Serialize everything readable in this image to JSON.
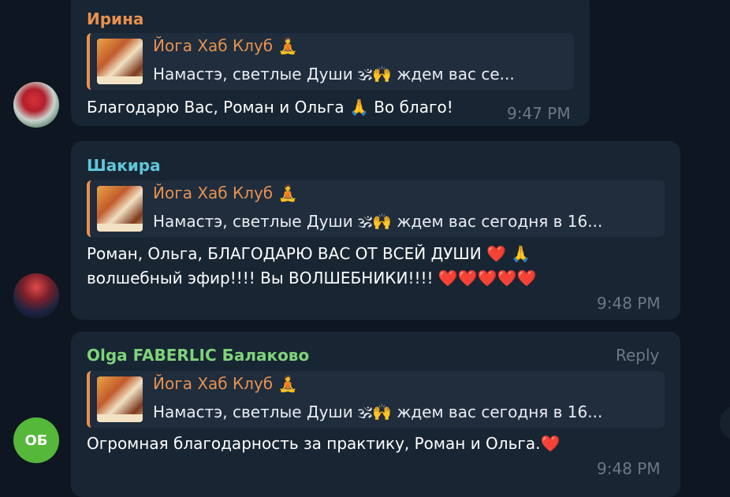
{
  "messages": [
    {
      "sender": "Ирина",
      "sender_color": "#e8914e",
      "quote_title": "Йога Хаб Клуб 🧘",
      "quote_text": "Намастэ, светлые Души 🕉🙌 ждем вас се...",
      "text_lines": [
        "Благодарю Вас, Роман и Ольга 🙏 Во благо!"
      ],
      "time": "9:47 PM"
    },
    {
      "sender": "Шакира",
      "sender_color": "#5fc6d8",
      "quote_title": "Йога Хаб Клуб 🧘",
      "quote_text": "Намастэ, светлые Души 🕉🙌 ждем вас сегодня в 16...",
      "text_lines": [
        "Роман, Ольга, БЛАГОДАРЮ ВАС ОТ ВСЕЙ ДУШИ ❤️ 🙏",
        "волшебный эфир!!!! Вы ВОЛШЕБНИКИ!!!! ❤️❤️❤️❤️❤️"
      ],
      "time": "9:48 PM"
    },
    {
      "sender": "Olga FABERLIC Балаково",
      "sender_color": "#7fd37b",
      "reply_label": "Reply",
      "quote_title": "Йога Хаб Клуб 🧘",
      "quote_text": "Намастэ, светлые Души 🕉🙌 ждем вас сегодня в 16...",
      "text_lines": [
        "Огромная благодарность за практику, Роман и Ольга.❤️"
      ],
      "time": "9:48 PM",
      "avatar_initials": "ОБ",
      "avatar_color": "#55b83a"
    }
  ]
}
